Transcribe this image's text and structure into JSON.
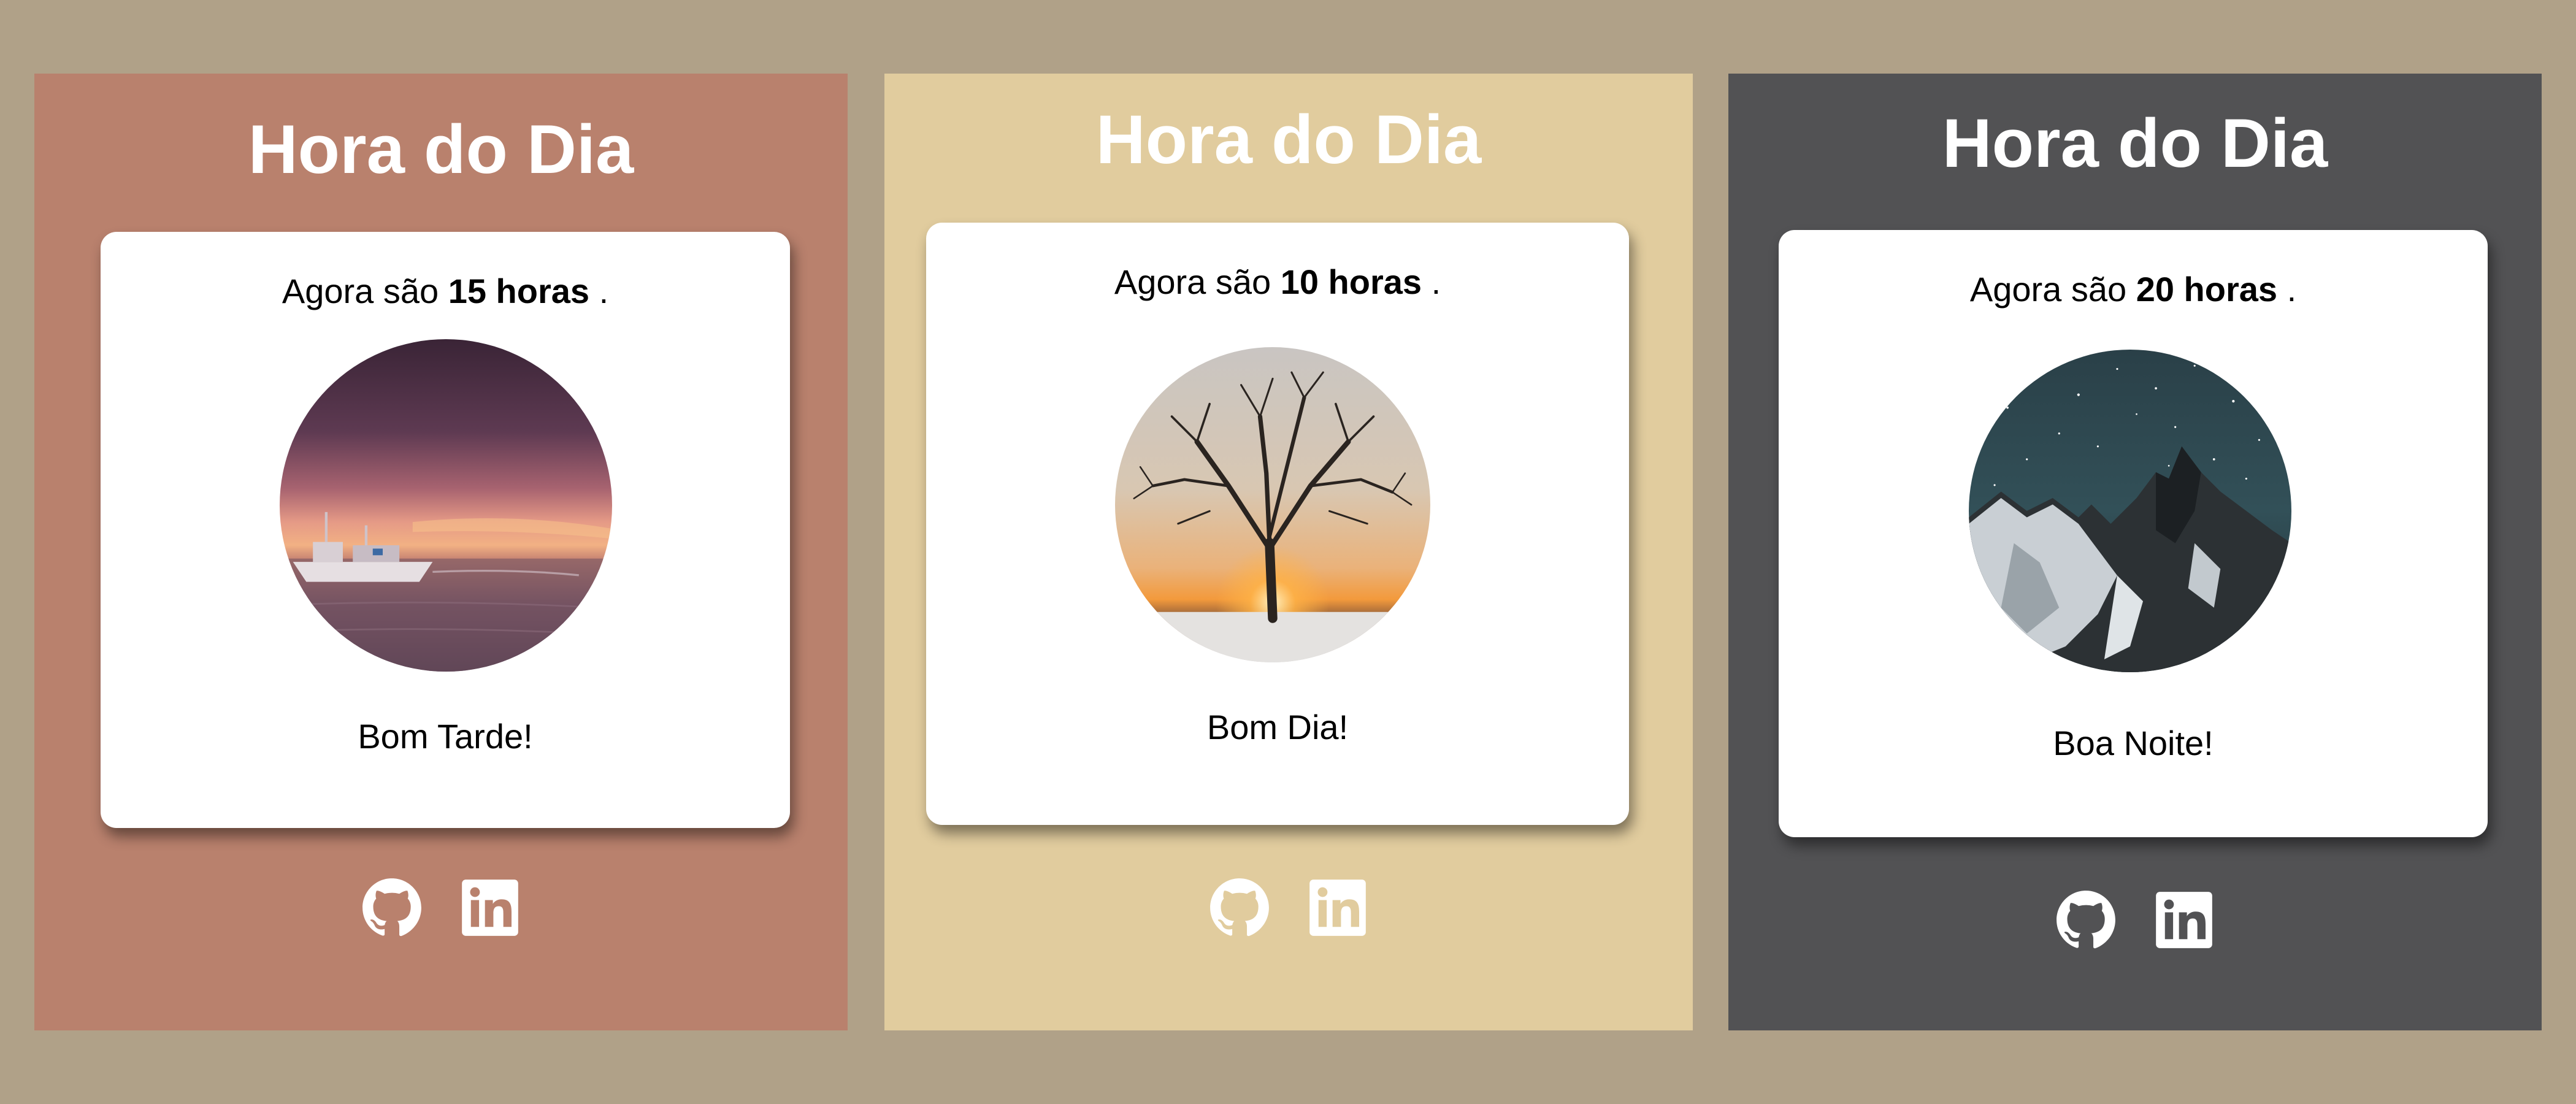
{
  "cards": [
    {
      "theme": "afternoon",
      "background": "#b9816d",
      "title": "Hora do Dia",
      "time_prefix": "Agora são",
      "time_value": "15 horas",
      "time_suffix": ".",
      "greeting": "Bom Tarde!",
      "image": "sunset-boat-sea",
      "icons": [
        "github-icon",
        "linkedin-icon"
      ]
    },
    {
      "theme": "morning",
      "background": "#e1cc9e",
      "title": "Hora do Dia",
      "time_prefix": "Agora são",
      "time_value": "10 horas",
      "time_suffix": ".",
      "greeting": "Bom Dia!",
      "image": "tree-sunrise",
      "icons": [
        "github-icon",
        "linkedin-icon"
      ]
    },
    {
      "theme": "night",
      "background": "#525254",
      "title": "Hora do Dia",
      "time_prefix": "Agora são",
      "time_value": "20 horas",
      "time_suffix": ".",
      "greeting": "Boa Noite!",
      "image": "starry-mountains",
      "icons": [
        "github-icon",
        "linkedin-icon"
      ]
    }
  ],
  "page_background": "#b0a188"
}
